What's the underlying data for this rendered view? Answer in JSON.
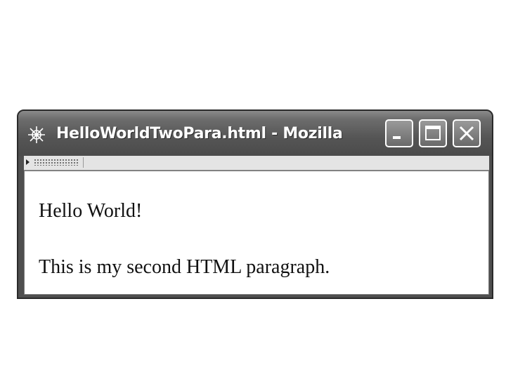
{
  "window": {
    "title": "HelloWorldTwoPara.html - Mozilla",
    "app_icon": "mozilla-app-icon",
    "controls": {
      "minimize_icon": "minimize-icon",
      "maximize_icon": "maximize-icon",
      "close_icon": "close-icon"
    }
  },
  "toolbar": {
    "grip_icon": "toolbar-grip-icon"
  },
  "content": {
    "paragraphs": [
      "Hello World!",
      "This is my second HTML paragraph."
    ]
  },
  "colors": {
    "titlebar": "#555555",
    "frame": "#4f4f4f",
    "page_background": "#ffffff",
    "text": "#111111"
  }
}
